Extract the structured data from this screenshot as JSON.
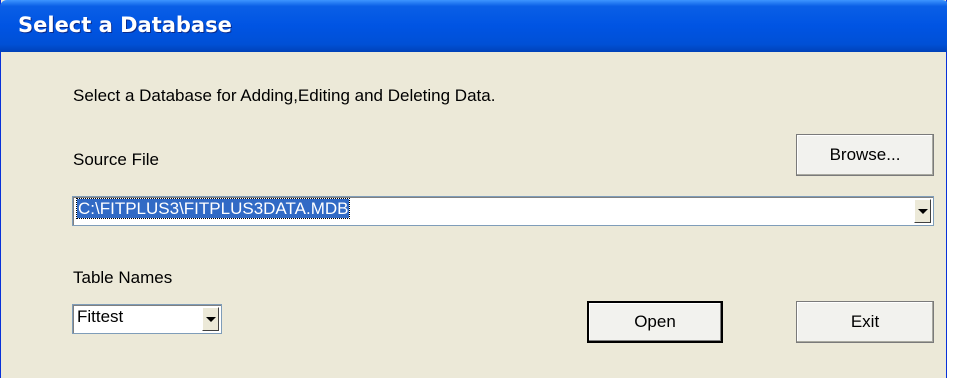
{
  "window": {
    "title": "Select a Database"
  },
  "dialog": {
    "instruction": "Select a Database for Adding,Editing and Deleting Data.",
    "source_file_label": "Source File",
    "browse_label": "Browse...",
    "source_file_value": "C:\\FITPLUS3\\FITPLUS3DATA.MDB",
    "table_names_label": "Table Names",
    "table_name_value": "Fittest",
    "open_label": "Open",
    "exit_label": "Exit"
  },
  "icons": {
    "dropdown": "chevron-down-icon"
  },
  "colors": {
    "titlebar": "#0054e3",
    "dialog_bg": "#ece9d8",
    "selection": "#316ac5"
  }
}
